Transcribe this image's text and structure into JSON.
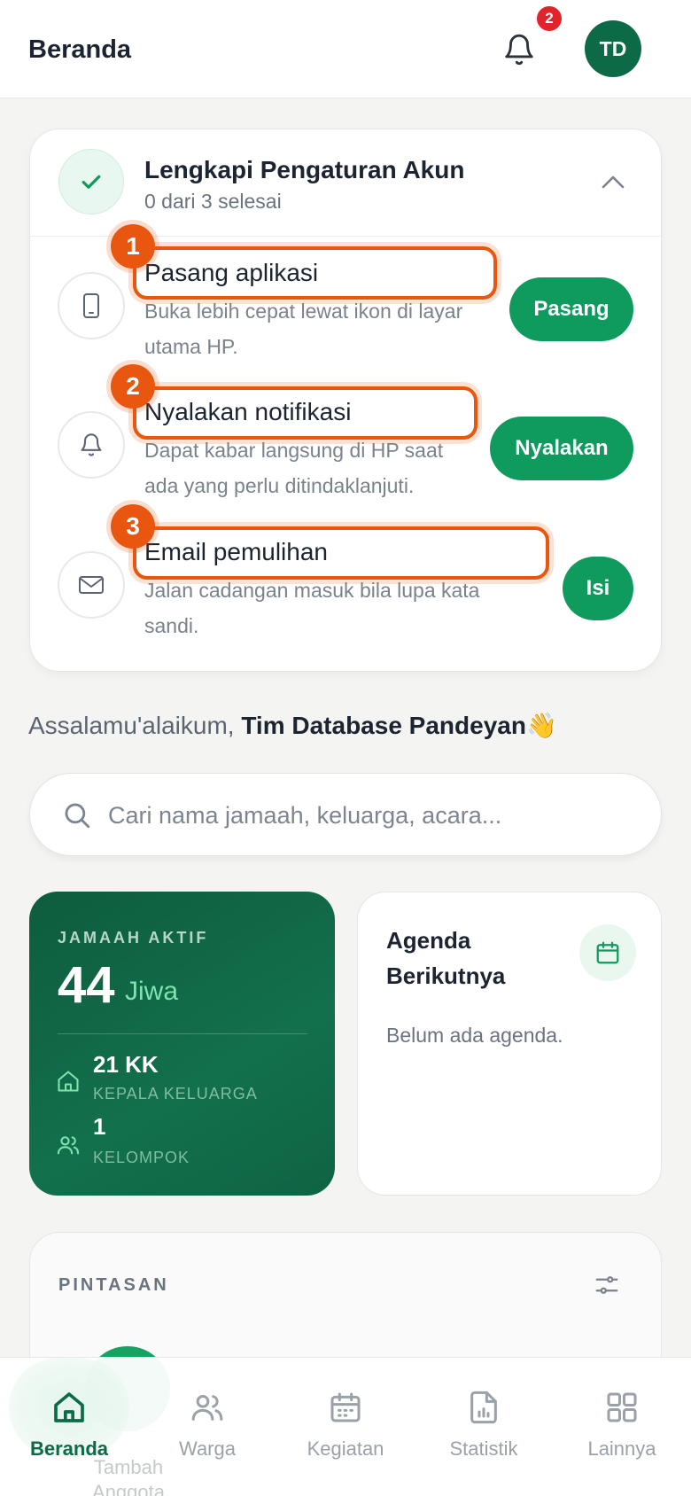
{
  "header": {
    "title": "Beranda",
    "notification_count": "2",
    "avatar_initials": "TD"
  },
  "setup": {
    "title": "Lengkapi Pengaturan Akun",
    "progress": "0 dari 3 selesai",
    "tasks": [
      {
        "number": "1",
        "title": "Pasang aplikasi",
        "desc": "Buka lebih cepat lewat ikon di layar utama HP.",
        "button": "Pasang",
        "icon": "smartphone-icon"
      },
      {
        "number": "2",
        "title": "Nyalakan notifikasi",
        "desc": "Dapat kabar langsung di HP saat ada yang perlu ditindaklanjuti.",
        "button": "Nyalakan",
        "icon": "bell-icon"
      },
      {
        "number": "3",
        "title": "Email pemulihan",
        "desc": "Jalan cadangan masuk bila lupa kata sandi.",
        "button": "Isi",
        "icon": "mail-icon"
      }
    ]
  },
  "greeting": {
    "prefix": "Assalamu'alaikum, ",
    "name": "Tim Database Pandeyan",
    "emoji": "👋"
  },
  "search": {
    "placeholder": "Cari nama jamaah, keluarga, acara..."
  },
  "stats": {
    "label": "JAMAAH AKTIF",
    "count": "44",
    "unit": "Jiwa",
    "families_value": "21 KK",
    "families_label": "KEPALA KELUARGA",
    "groups_value": "1",
    "groups_label": "KELOMPOK"
  },
  "agenda": {
    "title": "Agenda Berikutnya",
    "empty": "Belum ada agenda."
  },
  "shortcuts": {
    "title": "PINTASAN",
    "peek_label": "Tambah Anggota"
  },
  "nav": [
    {
      "label": "Beranda",
      "icon": "home-icon",
      "active": true
    },
    {
      "label": "Warga",
      "icon": "users-icon",
      "active": false
    },
    {
      "label": "Kegiatan",
      "icon": "calendar-icon",
      "active": false
    },
    {
      "label": "Statistik",
      "icon": "chart-file-icon",
      "active": false
    },
    {
      "label": "Lainnya",
      "icon": "grid-icon",
      "active": false
    }
  ],
  "colors": {
    "primary": "#0d6a47",
    "button": "#0f9a5e",
    "highlight": "#e8560f",
    "badge": "#e0242c"
  }
}
